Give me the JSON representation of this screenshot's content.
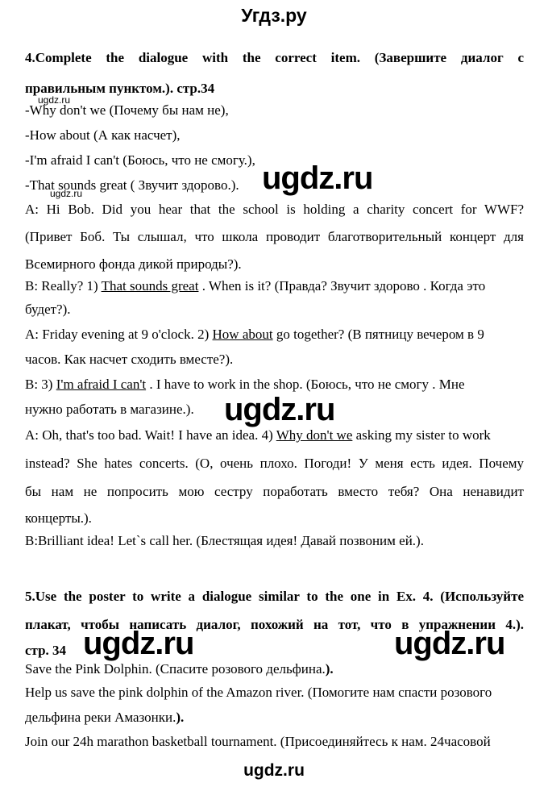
{
  "header": {
    "site_title": "Угдз.ру"
  },
  "footer": {
    "site_watermark": "ugdz.ru"
  },
  "watermarks": {
    "small": "ugdz.ru",
    "big": "ugdz.ru"
  },
  "exercise4": {
    "title_line1": "4.Complete the dialogue with the correct item. (Завершите диалог с",
    "title_line2": "правильным пунктом.). стр.34",
    "options": [
      "-Why don't we (Почему бы нам не),",
      "-How about (А как насчет),",
      "-I'm afraid I can't  (Боюсь, что не смогу.),",
      "-That sounds great ( Звучит здорово.)."
    ],
    "dialogue": {
      "a1_line1": "A: Hi Bob. Did you hear that the school is holding a charity concert for WWF?",
      "a1_line2": "(Привет Боб. Ты слышал, что школа проводит благотворительный концерт для",
      "a1_line3": "Всемирного фонда дикой природы?).",
      "b1_pre": "B: Really? 1) ",
      "b1_answer": "That sounds great",
      "b1_post": " . When is it? (Правда? Звучит здорово . Когда это",
      "b1_line2": "будет?).",
      "a2_pre": "A: Friday evening at 9 o'clock. 2) ",
      "a2_answer": "How about",
      "a2_post": "  go together? (В пятницу вечером в 9",
      "a2_line2": "часов. Как насчет сходить вместе?).",
      "b2_pre": "B: 3) ",
      "b2_answer": "I'm afraid I can't",
      "b2_post": " . I have to work in the shop. (Боюсь, что не смогу . Мне",
      "b2_line2": "нужно работать в магазине.).",
      "a3_pre": "A: Oh, that's too bad. Wait! I have an idea. 4) ",
      "a3_answer": "Why don't we",
      "a3_post": "  asking my sister to work",
      "a3_line2": "instead? She hates concerts. (О, очень плохо. Погоди! У меня есть идея. Почему",
      "a3_line3": "бы нам не попросить мою сестру поработать вместо тебя? Она ненавидит",
      "a3_line4": "концерты.).",
      "b3_line1": "B:Brilliant idea! Let`s call her. (Блестящая идея! Давай позвоним ей.)."
    }
  },
  "exercise5": {
    "title_line1": "5.Use the poster to write a dialogue similar to the one in Ex. 4. (Используйте",
    "title_line2": "плакат, чтобы написать диалог, похожий на тот, что в упражнении 4.).",
    "title_line3": "стр. 34",
    "lines": [
      {
        "text": "Save the Pink Dolphin. (Спасите розового дельфина.",
        "bold_tail": ")."
      },
      {
        "text": "Help us save the pink dolphin of the Amazon river. (Помогите нам спасти розового",
        "bold_tail": ""
      },
      {
        "text": "дельфина реки Амазонки.",
        "bold_tail": ")."
      },
      {
        "text": "Join our 24h marathon basketball tournament. (Присоединяйтесь к нам. 24часовой",
        "bold_tail": ""
      }
    ]
  }
}
